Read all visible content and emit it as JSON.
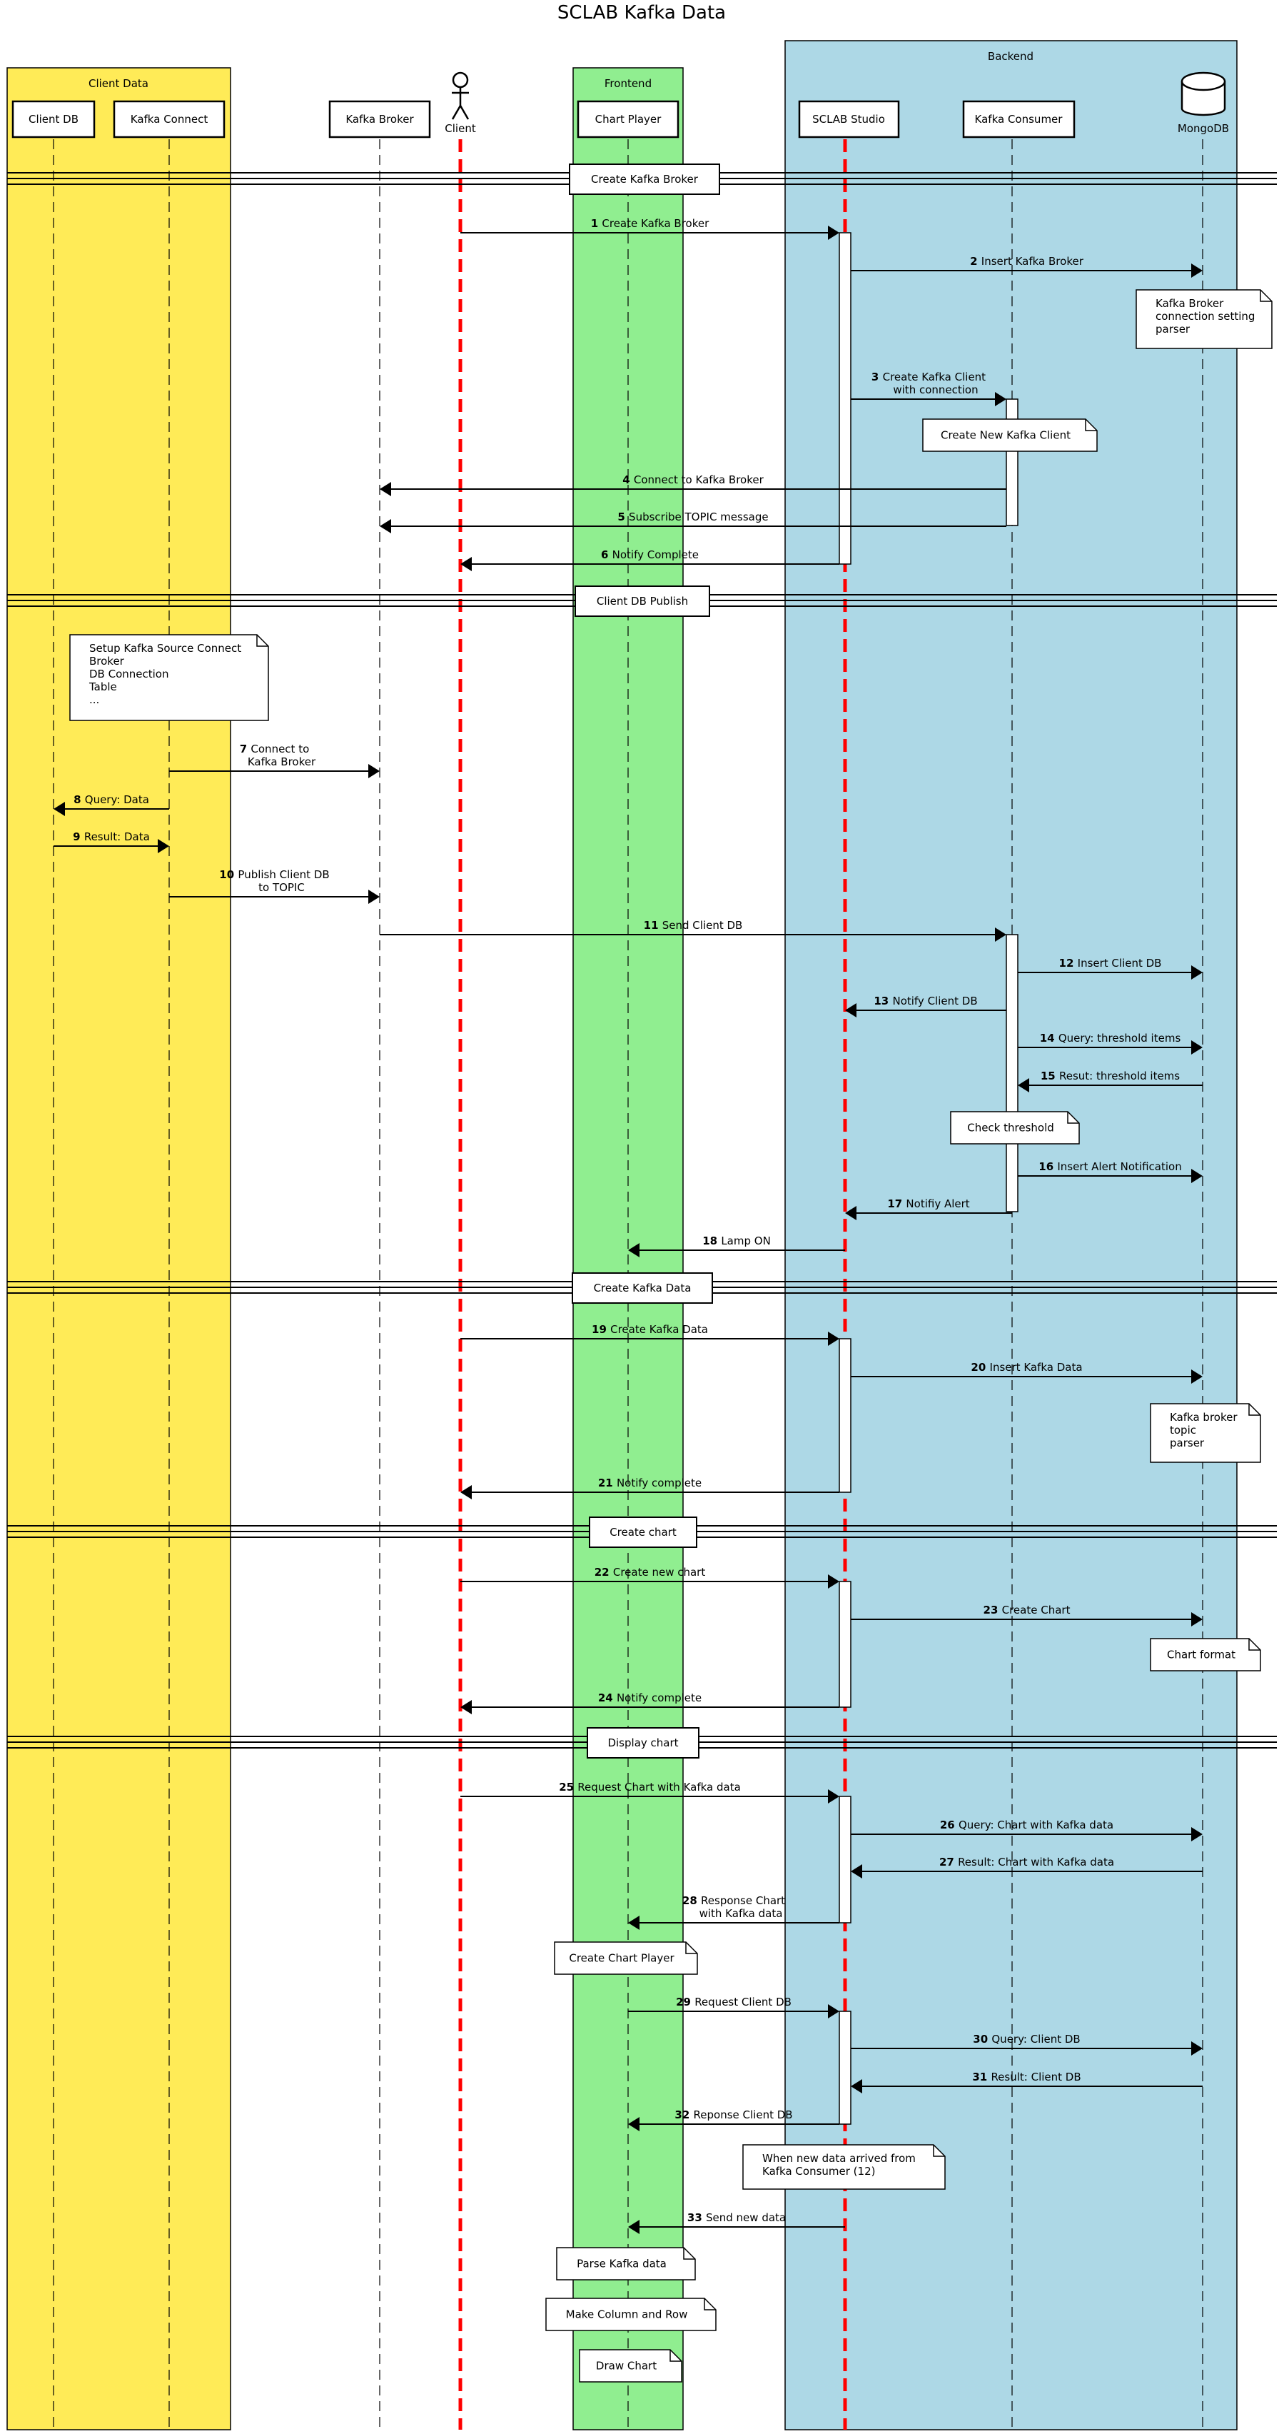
{
  "title": "SCLAB Kafka Data",
  "colors": {
    "client_data_box": "#FFEB57",
    "frontend_box": "#90EE90",
    "backend_box": "#ADD8E6",
    "highlight_lifeline": "#FF0000",
    "line": "#000000",
    "note_fill": "#FFFFFF"
  },
  "groups": [
    {
      "id": "client-data",
      "label": "Client Data"
    },
    {
      "id": "frontend",
      "label": "Frontend"
    },
    {
      "id": "backend",
      "label": "Backend"
    }
  ],
  "participants": [
    {
      "id": "clientdb",
      "label": "Client DB",
      "kind": "participant",
      "group": "client-data",
      "highlight": false
    },
    {
      "id": "kconnect",
      "label": "Kafka Connect",
      "kind": "participant",
      "group": "client-data",
      "highlight": false
    },
    {
      "id": "kbroker",
      "label": "Kafka Broker",
      "kind": "participant",
      "group": "",
      "highlight": false
    },
    {
      "id": "client",
      "label": "Client",
      "kind": "actor",
      "group": "",
      "highlight": true
    },
    {
      "id": "chartplayer",
      "label": "Chart Player",
      "kind": "participant",
      "group": "frontend",
      "highlight": false
    },
    {
      "id": "sclab",
      "label": "SCLAB Studio",
      "kind": "participant",
      "group": "backend",
      "highlight": true
    },
    {
      "id": "kconsumer",
      "label": "Kafka Consumer",
      "kind": "participant",
      "group": "backend",
      "highlight": false
    },
    {
      "id": "mongodb",
      "label": "MongoDB",
      "kind": "database",
      "group": "backend",
      "highlight": false
    }
  ],
  "dividers": [
    {
      "label": "Create Kafka Broker"
    },
    {
      "label": "Client DB Publish"
    },
    {
      "label": "Create Kafka Data"
    },
    {
      "label": "Create chart"
    },
    {
      "label": "Display chart"
    }
  ],
  "messages": [
    {
      "n": "1",
      "text": "Create Kafka Broker",
      "from": "client",
      "to": "sclab"
    },
    {
      "n": "2",
      "text": "Insert Kafka Broker",
      "from": "sclab",
      "to": "mongodb"
    },
    {
      "n": "3",
      "text": "Create Kafka Client\nwith connection",
      "from": "sclab",
      "to": "kconsumer"
    },
    {
      "n": "4",
      "text": "Connect to Kafka Broker",
      "from": "kconsumer",
      "to": "kbroker"
    },
    {
      "n": "5",
      "text": "Subscribe TOPIC message",
      "from": "kconsumer",
      "to": "kbroker"
    },
    {
      "n": "6",
      "text": "Notify Complete",
      "from": "sclab",
      "to": "client"
    },
    {
      "n": "7",
      "text": "Connect to\nKafka Broker",
      "from": "kconnect",
      "to": "kbroker"
    },
    {
      "n": "8",
      "text": "Query: Data",
      "from": "kconnect",
      "to": "clientdb"
    },
    {
      "n": "9",
      "text": "Result: Data",
      "from": "clientdb",
      "to": "kconnect"
    },
    {
      "n": "10",
      "text": "Publish Client DB\nto TOPIC",
      "from": "kconnect",
      "to": "kbroker"
    },
    {
      "n": "11",
      "text": "Send Client DB",
      "from": "kbroker",
      "to": "kconsumer"
    },
    {
      "n": "12",
      "text": "Insert Client DB",
      "from": "kconsumer",
      "to": "mongodb"
    },
    {
      "n": "13",
      "text": "Notify Client DB",
      "from": "kconsumer",
      "to": "sclab"
    },
    {
      "n": "14",
      "text": "Query: threshold items",
      "from": "kconsumer",
      "to": "mongodb"
    },
    {
      "n": "15",
      "text": "Resut: threshold items",
      "from": "mongodb",
      "to": "kconsumer"
    },
    {
      "n": "16",
      "text": "Insert Alert Notification",
      "from": "kconsumer",
      "to": "mongodb"
    },
    {
      "n": "17",
      "text": "Notifiy Alert",
      "from": "kconsumer",
      "to": "sclab"
    },
    {
      "n": "18",
      "text": "Lamp ON",
      "from": "sclab",
      "to": "chartplayer"
    },
    {
      "n": "19",
      "text": "Create Kafka Data",
      "from": "client",
      "to": "sclab"
    },
    {
      "n": "20",
      "text": "Insert Kafka Data",
      "from": "sclab",
      "to": "mongodb"
    },
    {
      "n": "21",
      "text": "Notify complete",
      "from": "sclab",
      "to": "client"
    },
    {
      "n": "22",
      "text": "Create new chart",
      "from": "client",
      "to": "sclab"
    },
    {
      "n": "23",
      "text": "Create Chart",
      "from": "sclab",
      "to": "mongodb"
    },
    {
      "n": "24",
      "text": "Notify complete",
      "from": "sclab",
      "to": "client"
    },
    {
      "n": "25",
      "text": "Request Chart with Kafka data",
      "from": "client",
      "to": "sclab"
    },
    {
      "n": "26",
      "text": "Query: Chart with Kafka data",
      "from": "sclab",
      "to": "mongodb"
    },
    {
      "n": "27",
      "text": "Result: Chart with Kafka data",
      "from": "mongodb",
      "to": "sclab"
    },
    {
      "n": "28",
      "text": "Response Chart\nwith Kafka data",
      "from": "sclab",
      "to": "chartplayer"
    },
    {
      "n": "29",
      "text": "Request Client DB",
      "from": "chartplayer",
      "to": "sclab"
    },
    {
      "n": "30",
      "text": "Query: Client DB",
      "from": "sclab",
      "to": "mongodb"
    },
    {
      "n": "31",
      "text": "Result: Client DB",
      "from": "mongodb",
      "to": "sclab"
    },
    {
      "n": "32",
      "text": "Reponse Client DB",
      "from": "sclab",
      "to": "chartplayer"
    },
    {
      "n": "33",
      "text": "Send new data",
      "from": "sclab",
      "to": "chartplayer"
    }
  ],
  "notes": [
    {
      "text": "Kafka Broker\nconnection setting\nparser",
      "over": "mongodb"
    },
    {
      "text": "Create New Kafka Client",
      "over": "kconsumer"
    },
    {
      "text": "Setup Kafka Source Connect\nBroker\nDB Connection\nTable\n...",
      "over": "kconnect"
    },
    {
      "text": "Check threshold",
      "over": "kconsumer"
    },
    {
      "text": "Kafka broker\ntopic\nparser",
      "over": "mongodb"
    },
    {
      "text": "Chart format",
      "over": "mongodb"
    },
    {
      "text": "Create Chart Player",
      "over": "chartplayer"
    },
    {
      "text": "When new data arrived from\nKafka Consumer (12)",
      "over": "sclab"
    },
    {
      "text": "Parse Kafka data",
      "over": "chartplayer"
    },
    {
      "text": "Make Column and Row",
      "over": "chartplayer"
    },
    {
      "text": "Draw Chart",
      "over": "chartplayer"
    }
  ]
}
